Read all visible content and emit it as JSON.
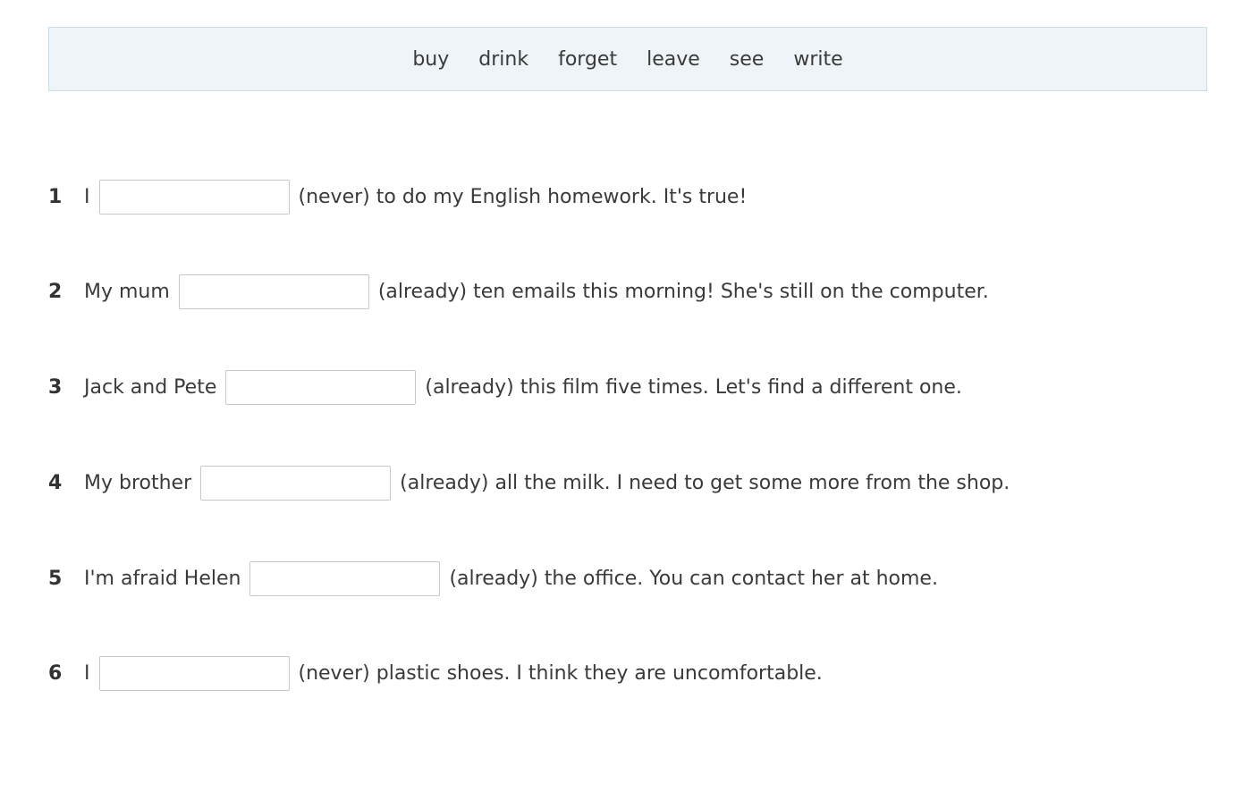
{
  "word_bank": [
    "buy",
    "drink",
    "forget",
    "leave",
    "see",
    "write"
  ],
  "items": [
    {
      "number": "1",
      "before": "I",
      "after": "(never) to do my English homework. It's true!",
      "value": ""
    },
    {
      "number": "2",
      "before": "My mum",
      "after": "(already) ten emails this morning! She's still on the computer.",
      "value": ""
    },
    {
      "number": "3",
      "before": "Jack and Pete",
      "after": "(already) this film five times. Let's find a different one.",
      "value": ""
    },
    {
      "number": "4",
      "before": "My brother",
      "after": "(already) all the milk. I need to get some more from the shop.",
      "value": ""
    },
    {
      "number": "5",
      "before": "I'm afraid Helen",
      "after": "(already) the office. You can contact her at home.",
      "value": ""
    },
    {
      "number": "6",
      "before": "I",
      "after": "(never) plastic shoes. I think they are uncomfortable.",
      "value": ""
    }
  ]
}
